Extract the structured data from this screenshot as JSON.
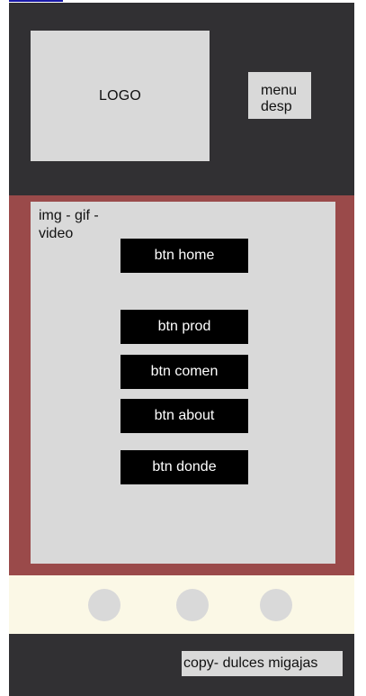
{
  "header": {
    "logo_text": "LOGO",
    "menu_line_1": "menu",
    "menu_line_2": "desp"
  },
  "hero": {
    "media_text": "img - gif - video",
    "buttons": [
      {
        "label": "btn home"
      },
      {
        "label": "btn prod"
      },
      {
        "label": "btn comen"
      },
      {
        "label": "btn about"
      },
      {
        "label": "btn donde"
      }
    ]
  },
  "footer": {
    "copyright": "copy- dulces migajas"
  },
  "colors": {
    "dark_bg": "#313033",
    "hero_border": "#9a4a4a",
    "placeholder_gray": "#d9d9d9",
    "button_black": "#000000",
    "social_band": "#fbf8e6",
    "top_link": "#1a1aa8"
  }
}
